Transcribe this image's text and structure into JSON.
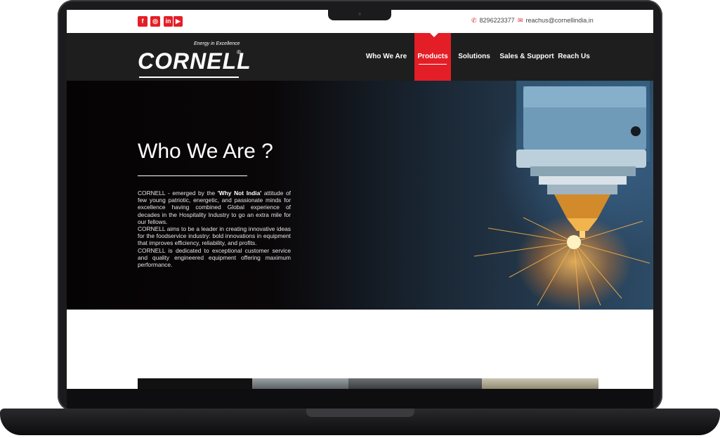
{
  "topbar": {
    "social": [
      {
        "icon": "facebook-icon",
        "glyph": "f"
      },
      {
        "icon": "instagram-icon",
        "glyph": "◎"
      },
      {
        "icon": "linkedin-icon",
        "glyph": "in"
      },
      {
        "icon": "youtube-icon",
        "glyph": "▶"
      }
    ],
    "phone": "8296223377",
    "email": "reachus@cornellindia.in"
  },
  "brand": {
    "tagline": "Energy in Excellence",
    "name": "CORNELL",
    "reg": "®"
  },
  "nav": {
    "items": [
      {
        "label": "Who We Are",
        "active": false
      },
      {
        "label": "Products",
        "active": true
      },
      {
        "label": "Solutions",
        "active": false
      },
      {
        "label": "Sales & Support",
        "active": false
      },
      {
        "label": "Reach Us",
        "active": false
      }
    ]
  },
  "hero": {
    "title": "Who We Are ?",
    "p1_before": "CORNELL - emerged by the ",
    "p1_bold": "'Why Not India'",
    "p1_after": " attitude of few young patriotic, energetic, and passionate minds for excellence having combined Global experience of decades in the Hospitality Industry to go an extra mile for our fellows.",
    "p2": "CORNELL aims to be a leader in creating innovative ideas for the foodservice industry: bold innovations in equipment that improves efficiency, reliability, and profits.",
    "p3": "CORNELL is dedicated to exceptional customer service and quality engineered equipment offering maximum performance."
  },
  "colors": {
    "accent": "#e41e26",
    "nav_bg": "#1e1e1e"
  }
}
